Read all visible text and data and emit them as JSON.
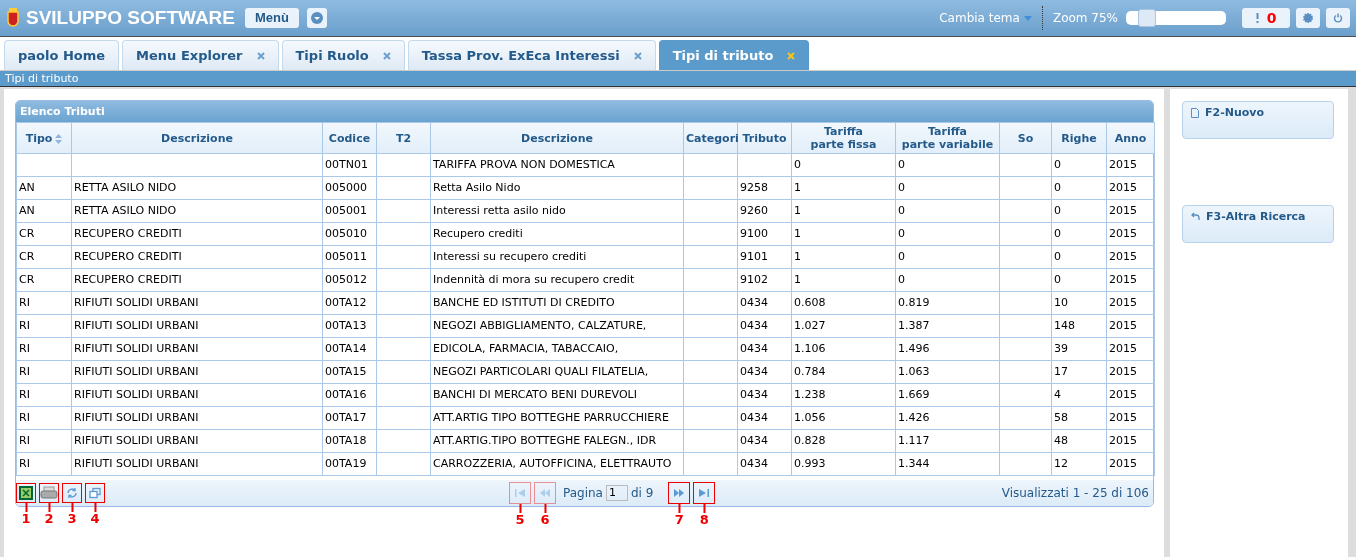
{
  "header": {
    "title": "SVILUPPO SOFTWARE",
    "menu_button": "Menù",
    "theme_menu": "Cambia tema",
    "zoom_label": "Zoom 75%",
    "zoom": {
      "level": 0.15
    },
    "alerts_count": "0"
  },
  "tabs": [
    {
      "label": "paolo Home",
      "closable": false,
      "selected": false
    },
    {
      "label": "Menu Explorer",
      "closable": true,
      "selected": false
    },
    {
      "label": "Tipi Ruolo",
      "closable": true,
      "selected": false
    },
    {
      "label": "Tassa Prov. ExEca Interessi",
      "closable": true,
      "selected": false
    },
    {
      "label": "Tipi di tributo",
      "closable": true,
      "selected": true
    }
  ],
  "breadcrumb": "Tipi di tributo",
  "grid": {
    "title": "Elenco Tributi",
    "columns": [
      {
        "label": "Tipo",
        "sorted": true
      },
      {
        "label": "Descrizione",
        "sorted": false
      },
      {
        "label": "Codice",
        "sorted": false
      },
      {
        "label": "T2",
        "sorted": false
      },
      {
        "label": "Descrizione",
        "sorted": false
      },
      {
        "label": "Categori",
        "sorted": false
      },
      {
        "label": "Tributo",
        "sorted": false
      },
      {
        "label": "Tariffa\nparte fissa",
        "sorted": false
      },
      {
        "label": "Tariffa\nparte variabile",
        "sorted": false
      },
      {
        "label": "So",
        "sorted": false
      },
      {
        "label": "Righe",
        "sorted": false
      },
      {
        "label": "Anno",
        "sorted": false
      }
    ],
    "rows": [
      [
        "",
        "",
        "00TN01",
        "",
        "TARIFFA PROVA NON DOMESTICA",
        "",
        "",
        "0",
        "0",
        "",
        "0",
        "2015"
      ],
      [
        "AN",
        "RETTA ASILO NIDO",
        "005000",
        "",
        "Retta Asilo Nido",
        "",
        "9258",
        "1",
        "0",
        "",
        "0",
        "2015"
      ],
      [
        "AN",
        "RETTA ASILO NIDO",
        "005001",
        "",
        "Interessi retta asilo nido",
        "",
        "9260",
        "1",
        "0",
        "",
        "0",
        "2015"
      ],
      [
        "CR",
        "RECUPERO CREDITI",
        "005010",
        "",
        "Recupero crediti",
        "",
        "9100",
        "1",
        "0",
        "",
        "0",
        "2015"
      ],
      [
        "CR",
        "RECUPERO CREDITI",
        "005011",
        "",
        "Interessi su recupero crediti",
        "",
        "9101",
        "1",
        "0",
        "",
        "0",
        "2015"
      ],
      [
        "CR",
        "RECUPERO CREDITI",
        "005012",
        "",
        "Indennità di mora su recupero credit",
        "",
        "9102",
        "1",
        "0",
        "",
        "0",
        "2015"
      ],
      [
        "RI",
        "RIFIUTI SOLIDI URBANI",
        "00TA12",
        "",
        "BANCHE ED ISTITUTI DI CREDITO",
        "",
        "0434",
        "0.608",
        "0.819",
        "",
        "10",
        "2015"
      ],
      [
        "RI",
        "RIFIUTI SOLIDI URBANI",
        "00TA13",
        "",
        "NEGOZI ABBIGLIAMENTO, CALZATURE,",
        "",
        "0434",
        "1.027",
        "1.387",
        "",
        "148",
        "2015"
      ],
      [
        "RI",
        "RIFIUTI SOLIDI URBANI",
        "00TA14",
        "",
        "EDICOLA, FARMACIA, TABACCAIO,",
        "",
        "0434",
        "1.106",
        "1.496",
        "",
        "39",
        "2015"
      ],
      [
        "RI",
        "RIFIUTI SOLIDI URBANI",
        "00TA15",
        "",
        "NEGOZI PARTICOLARI QUALI FILATELIA,",
        "",
        "0434",
        "0.784",
        "1.063",
        "",
        "17",
        "2015"
      ],
      [
        "RI",
        "RIFIUTI SOLIDI URBANI",
        "00TA16",
        "",
        "BANCHI DI MERCATO BENI DUREVOLI",
        "",
        "0434",
        "1.238",
        "1.669",
        "",
        "4",
        "2015"
      ],
      [
        "RI",
        "RIFIUTI SOLIDI URBANI",
        "00TA17",
        "",
        "ATT.ARTIG TIPO BOTTEGHE PARRUCCHIERE",
        "",
        "0434",
        "1.056",
        "1.426",
        "",
        "58",
        "2015"
      ],
      [
        "RI",
        "RIFIUTI SOLIDI URBANI",
        "00TA18",
        "",
        "ATT.ARTIG.TIPO BOTTEGHE FALEGN., IDR",
        "",
        "0434",
        "0.828",
        "1.117",
        "",
        "48",
        "2015"
      ],
      [
        "RI",
        "RIFIUTI SOLIDI URBANI",
        "00TA19",
        "",
        "CARROZZERIA, AUTOFFICINA, ELETTRAUTO",
        "",
        "0434",
        "0.993",
        "1.344",
        "",
        "12",
        "2015"
      ]
    ],
    "tools": [
      {
        "kind": "excel",
        "callout": "1"
      },
      {
        "kind": "print",
        "callout": "2"
      },
      {
        "kind": "refresh",
        "callout": "3"
      },
      {
        "kind": "window",
        "callout": "4"
      }
    ],
    "pager": {
      "first": {
        "callout": "5",
        "disabled": true
      },
      "prev": {
        "callout": "6",
        "disabled": true
      },
      "page_label": "Pagina",
      "page": "1",
      "of_label": "di 9",
      "next": {
        "callout": "7",
        "disabled": false
      },
      "last": {
        "callout": "8",
        "disabled": false
      }
    },
    "status": "Visualizzati 1 - 25 di 106"
  },
  "actions": [
    {
      "kind": "new",
      "label": "F2-Nuovo"
    },
    {
      "kind": "back",
      "label": "F3-Altra Ricerca"
    }
  ]
}
